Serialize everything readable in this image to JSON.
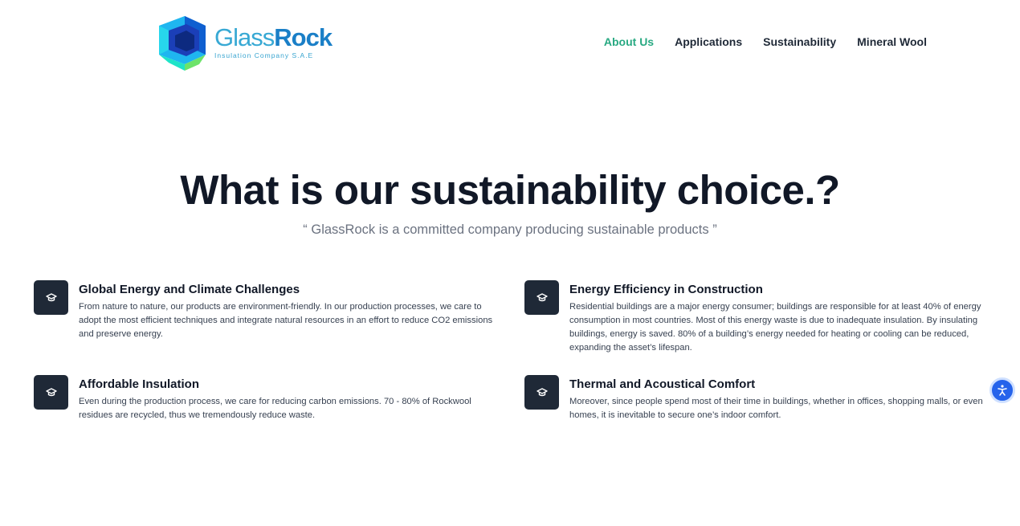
{
  "header": {
    "brand_light": "Glass",
    "brand_bold": "Rock",
    "tagline": "Insulation Company S.A.E",
    "nav": [
      {
        "label": "About Us"
      },
      {
        "label": "Applications"
      },
      {
        "label": "Sustainability"
      },
      {
        "label": "Mineral Wool"
      }
    ],
    "active_nav_color": "#28a982"
  },
  "hero": {
    "title": "What is our sustainability choice.?",
    "subtitle": "“ GlassRock is a committed company producing sustainable products ”"
  },
  "features": [
    {
      "icon": "graduation-cap-icon",
      "title": "Global Energy and Climate Challenges",
      "text": "From nature to nature, our products are environment-friendly. In our production processes, we care to adopt the most efficient techniques and integrate natural resources in an effort to reduce CO2 emissions and preserve energy."
    },
    {
      "icon": "graduation-cap-icon",
      "title": "Energy Efficiency in Construction",
      "text": "Residential buildings are a major energy consumer; buildings are responsible for at least 40% of energy consumption in most countries. Most of this energy waste is due to inadequate insulation. By insulating buildings, energy is saved. 80% of a building’s energy needed for heating or cooling can be reduced, expanding the asset’s lifespan."
    },
    {
      "icon": "graduation-cap-icon",
      "title": "Affordable Insulation",
      "text": "Even during the production process, we care for reducing carbon emissions. 70 - 80% of Rockwool residues are recycled, thus we tremendously reduce waste."
    },
    {
      "icon": "graduation-cap-icon",
      "title": "Thermal and Acoustical Comfort",
      "text": "Moreover, since people spend most of their time in buildings, whether in offices, shopping malls, or even homes, it is inevitable to secure one’s indoor comfort."
    }
  ],
  "widget": {
    "icon": "accessibility-icon",
    "color": "#2563eb"
  }
}
